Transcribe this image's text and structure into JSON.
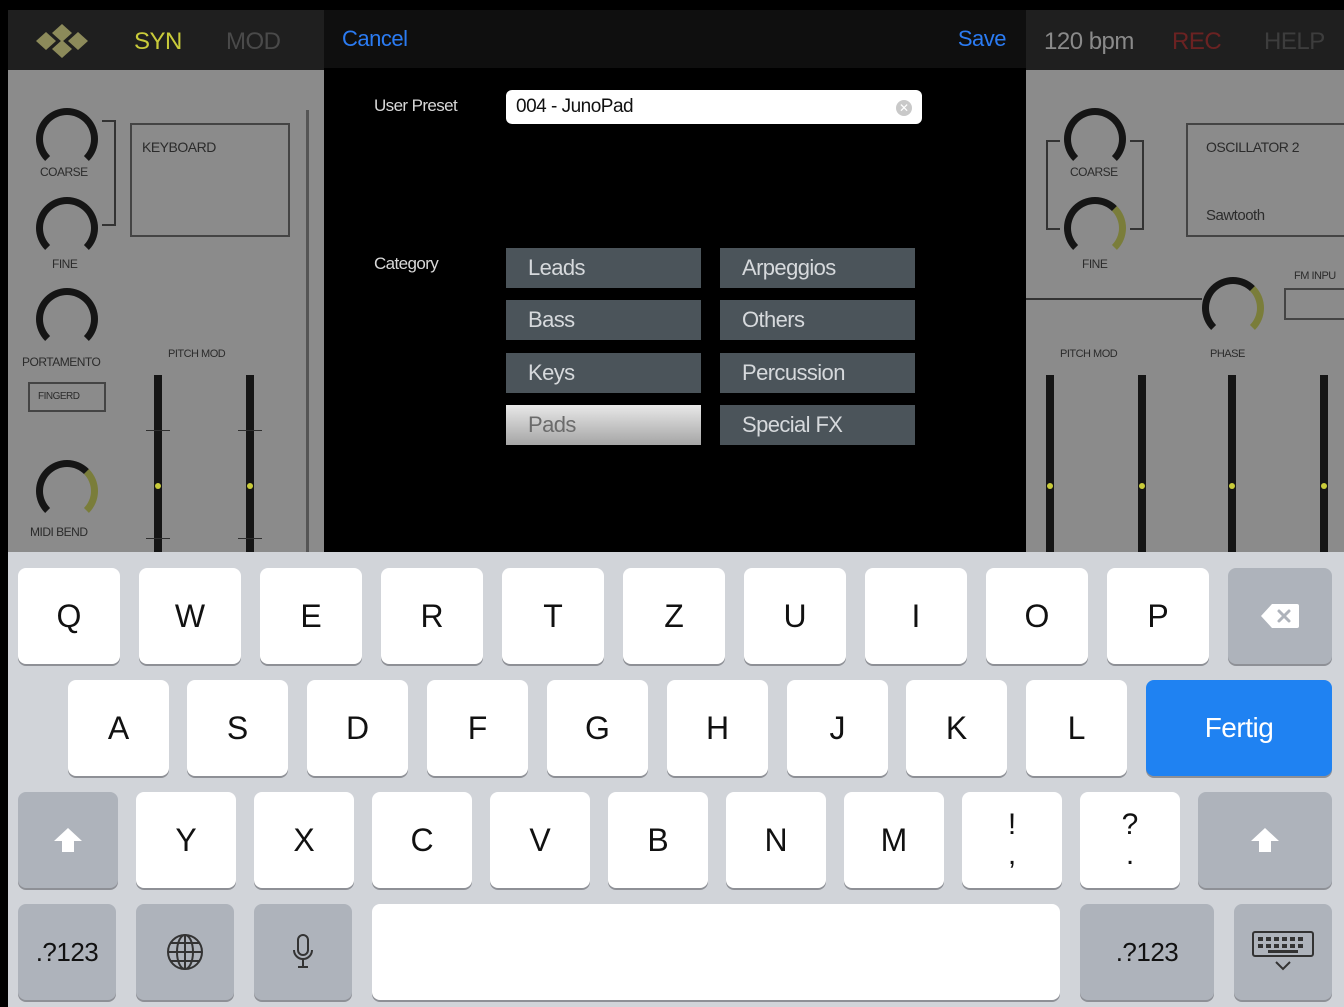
{
  "topbar": {
    "tabs": [
      "SYN",
      "MOD"
    ],
    "bpm": "120 bpm",
    "rec": "REC",
    "help": "HELP"
  },
  "left_panel": {
    "knobs": [
      "COARSE",
      "FINE",
      "PORTAMENTO",
      "MIDI BEND"
    ],
    "box_title": "KEYBOARD",
    "fingered": "FINGERD",
    "pitch_mod": "PITCH MOD"
  },
  "right_panel": {
    "knobs": [
      "COARSE",
      "FINE",
      "PHASE"
    ],
    "box_title": "OSCILLATOR 2",
    "waveform": "Sawtooth",
    "fm_input": "FM INPU",
    "pitch_mod": "PITCH MOD"
  },
  "dialog": {
    "cancel": "Cancel",
    "save": "Save",
    "preset_label": "User Preset",
    "preset_value": "004 - JunoPad",
    "category_label": "Category",
    "categories": [
      "Leads",
      "Arpeggios",
      "Bass",
      "Others",
      "Keys",
      "Percussion",
      "Pads",
      "Special FX"
    ],
    "selected_category": "Pads"
  },
  "keyboard": {
    "row1": [
      "Q",
      "W",
      "E",
      "R",
      "T",
      "Z",
      "U",
      "I",
      "O",
      "P"
    ],
    "row2": [
      "A",
      "S",
      "D",
      "F",
      "G",
      "H",
      "J",
      "K",
      "L"
    ],
    "done": "Fertig",
    "row3": [
      "Y",
      "X",
      "C",
      "V",
      "B",
      "N",
      "M"
    ],
    "punct1": [
      "!",
      ","
    ],
    "punct2": [
      "?",
      "."
    ],
    "numbers": ".?123",
    "icons": [
      "delete-icon",
      "shift-icon",
      "globe-icon",
      "microphone-icon",
      "hide-keyboard-icon"
    ]
  },
  "colors": {
    "accent": "#2b7bf2",
    "syn_active": "#c9cb3a",
    "category_bg": "#4b545a",
    "keyboard_bg": "#d1d4d9",
    "done_key": "#1f82f2"
  }
}
